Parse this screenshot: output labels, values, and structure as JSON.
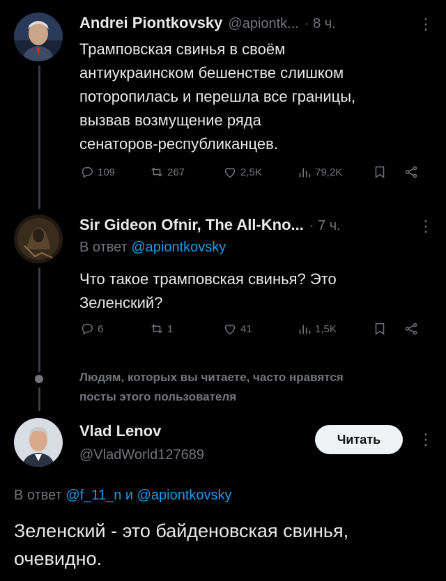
{
  "tweets": [
    {
      "author": "Andrei Piontkovsky",
      "handle": "@apiontk...",
      "time": "· 8 ч.",
      "text_lines": [
        "Трамповская свинья в своём",
        "антиукраинском бешенстве слишком",
        "поторопилась и перешла все границы,",
        "вызвав возмущение ряда",
        "сенаторов-республиканцев."
      ],
      "replies": "109",
      "retweets": "267",
      "likes": "2,5K",
      "views": "79,2K"
    },
    {
      "author": "Sir Gideon Ofnir, The All-Kno...",
      "time": "· 7 ч.",
      "reply_prefix": "В ответ",
      "reply_to": "@apiontkovsky",
      "text_lines": [
        "Что такое трамповская свинья? Это",
        "Зеленский?"
      ],
      "replies": "6",
      "retweets": "1",
      "likes": "41",
      "views": "1,5K"
    }
  ],
  "suggestion": {
    "line1": "Людям, которых вы читаете, часто нравятся",
    "line2": "посты этого пользователя"
  },
  "main_post": {
    "author": "Vlad Lenov",
    "handle": "@VladWorld127689",
    "follow_label": "Читать",
    "reply_prefix": "В ответ",
    "reply_user1": "@f_11_n",
    "reply_and": "и",
    "reply_user2": "@apiontkovsky",
    "text_line1": "Зеленский - это байденовская свинья,",
    "text_line2": "очевидно."
  },
  "colors": {
    "background": "#000000",
    "text": "#e7e9ea",
    "muted": "#71767b",
    "link": "#1d9bf0",
    "thread_line": "#3a3d41"
  }
}
